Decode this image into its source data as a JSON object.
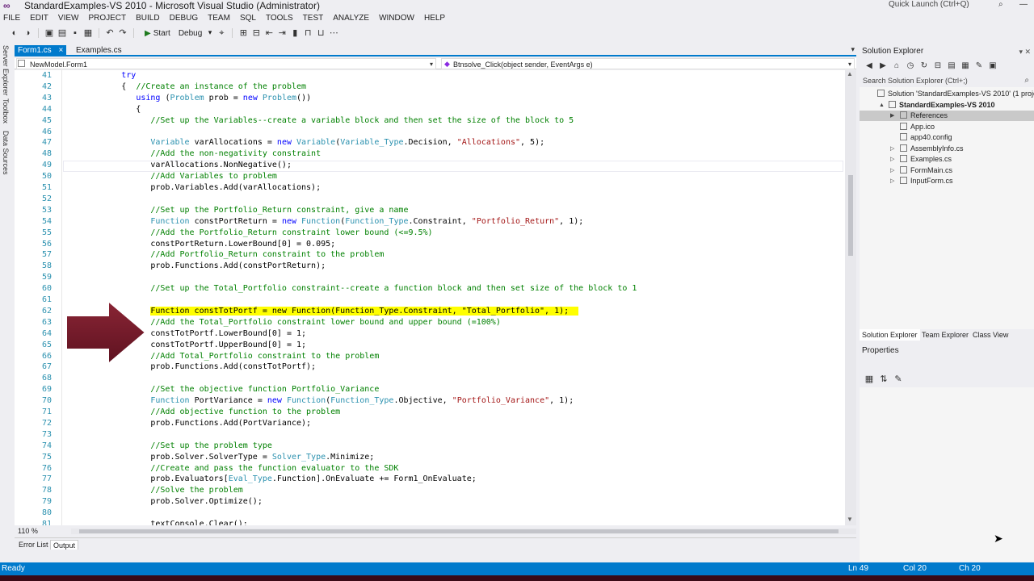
{
  "window": {
    "title": "StandardExamples-VS 2010 - Microsoft Visual Studio (Administrator)",
    "quick_launch": "Quick Launch (Ctrl+Q)"
  },
  "menu": [
    "FILE",
    "EDIT",
    "VIEW",
    "PROJECT",
    "BUILD",
    "DEBUG",
    "TEAM",
    "SQL",
    "TOOLS",
    "TEST",
    "ANALYZE",
    "WINDOW",
    "HELP"
  ],
  "toolbar": {
    "start_label": "Start",
    "config_label": "Debug"
  },
  "left_strip": [
    "Server Explorer",
    "Toolbox",
    "Data Sources"
  ],
  "doc_tabs": [
    {
      "label": "Form1.cs",
      "active": true
    },
    {
      "label": "Examples.cs",
      "active": false
    }
  ],
  "nav": {
    "class_selector": "NewModel.Form1",
    "member_selector": "Btnsolve_Click(object sender, EventArgs e)"
  },
  "editor": {
    "zoom": "110 %",
    "lines": [
      {
        "n": "41",
        "parts": [
          {
            "t": "            "
          },
          {
            "t": "try",
            "c": "kw"
          }
        ]
      },
      {
        "n": "42",
        "parts": [
          {
            "t": "            {  "
          },
          {
            "t": "//Create an instance of the problem",
            "c": "cm"
          }
        ]
      },
      {
        "n": "43",
        "parts": [
          {
            "t": "               "
          },
          {
            "t": "using",
            "c": "kw"
          },
          {
            "t": " ("
          },
          {
            "t": "Problem",
            "c": "ty"
          },
          {
            "t": " prob = "
          },
          {
            "t": "new",
            "c": "kw"
          },
          {
            "t": " "
          },
          {
            "t": "Problem",
            "c": "ty"
          },
          {
            "t": "())"
          }
        ]
      },
      {
        "n": "44",
        "parts": [
          {
            "t": "               {"
          }
        ]
      },
      {
        "n": "45",
        "parts": [
          {
            "t": "                  "
          },
          {
            "t": "//Set up the Variables--create a variable block and then set the size of the block to 5",
            "c": "cm"
          }
        ]
      },
      {
        "n": "46",
        "parts": [
          {
            "t": ""
          }
        ]
      },
      {
        "n": "47",
        "parts": [
          {
            "t": "                  "
          },
          {
            "t": "Variable",
            "c": "ty"
          },
          {
            "t": " varAllocations = "
          },
          {
            "t": "new",
            "c": "kw"
          },
          {
            "t": " "
          },
          {
            "t": "Variable",
            "c": "ty"
          },
          {
            "t": "("
          },
          {
            "t": "Variable_Type",
            "c": "ty"
          },
          {
            "t": ".Decision, "
          },
          {
            "t": "\"Allocations\"",
            "c": "st"
          },
          {
            "t": ", 5);"
          }
        ]
      },
      {
        "n": "48",
        "parts": [
          {
            "t": "                  "
          },
          {
            "t": "//Add the non-negativity constraint",
            "c": "cm"
          }
        ]
      },
      {
        "n": "49",
        "parts": [
          {
            "t": "                  varAllocations.NonNegative();"
          }
        ]
      },
      {
        "n": "50",
        "parts": [
          {
            "t": "                  "
          },
          {
            "t": "//Add Variables to problem",
            "c": "cm"
          }
        ]
      },
      {
        "n": "51",
        "parts": [
          {
            "t": "                  prob.Variables.Add(varAllocations);"
          }
        ]
      },
      {
        "n": "52",
        "parts": [
          {
            "t": ""
          }
        ]
      },
      {
        "n": "53",
        "parts": [
          {
            "t": "                  "
          },
          {
            "t": "//Set up the Portfolio_Return constraint, give a name",
            "c": "cm"
          }
        ]
      },
      {
        "n": "54",
        "parts": [
          {
            "t": "                  "
          },
          {
            "t": "Function",
            "c": "ty"
          },
          {
            "t": " constPortReturn = "
          },
          {
            "t": "new",
            "c": "kw"
          },
          {
            "t": " "
          },
          {
            "t": "Function",
            "c": "ty"
          },
          {
            "t": "("
          },
          {
            "t": "Function_Type",
            "c": "ty"
          },
          {
            "t": ".Constraint, "
          },
          {
            "t": "\"Portfolio_Return\"",
            "c": "st"
          },
          {
            "t": ", 1);"
          }
        ]
      },
      {
        "n": "55",
        "parts": [
          {
            "t": "                  "
          },
          {
            "t": "//Add the Portfolio_Return constraint lower bound (<=9.5%)",
            "c": "cm"
          }
        ]
      },
      {
        "n": "56",
        "parts": [
          {
            "t": "                  constPortReturn.LowerBound[0] = 0.095;"
          }
        ]
      },
      {
        "n": "57",
        "parts": [
          {
            "t": "                  "
          },
          {
            "t": "//Add Portfolio_Return constraint to the problem",
            "c": "cm"
          }
        ]
      },
      {
        "n": "58",
        "parts": [
          {
            "t": "                  prob.Functions.Add(constPortReturn);"
          }
        ]
      },
      {
        "n": "59",
        "parts": [
          {
            "t": ""
          }
        ]
      },
      {
        "n": "60",
        "parts": [
          {
            "t": "                  "
          },
          {
            "t": "//Set up the Total_Portfolio constraint--create a function block and then set size of the block to 1",
            "c": "cm"
          }
        ]
      },
      {
        "n": "61",
        "parts": [
          {
            "t": ""
          }
        ]
      },
      {
        "n": "62",
        "highlight": true,
        "parts": [
          {
            "t": "                  Function constTotPortf = new Function(Function_Type.Constraint, \"Total_Portfolio\", 1);"
          }
        ]
      },
      {
        "n": "63",
        "parts": [
          {
            "t": "                  "
          },
          {
            "t": "//Add the Total_Portfolio constraint lower bound and upper bound (=100%)",
            "c": "cm"
          }
        ]
      },
      {
        "n": "64",
        "parts": [
          {
            "t": "                  constTotPortf.LowerBound[0] = 1;"
          }
        ]
      },
      {
        "n": "65",
        "parts": [
          {
            "t": "                  constTotPortf.UpperBound[0] = 1;"
          }
        ]
      },
      {
        "n": "66",
        "parts": [
          {
            "t": "                  "
          },
          {
            "t": "//Add Total_Portfolio constraint to the problem",
            "c": "cm"
          }
        ]
      },
      {
        "n": "67",
        "parts": [
          {
            "t": "                  prob.Functions.Add(constTotPortf);"
          }
        ]
      },
      {
        "n": "68",
        "parts": [
          {
            "t": ""
          }
        ]
      },
      {
        "n": "69",
        "parts": [
          {
            "t": "                  "
          },
          {
            "t": "//Set the objective function Portfolio_Variance",
            "c": "cm"
          }
        ]
      },
      {
        "n": "70",
        "parts": [
          {
            "t": "                  "
          },
          {
            "t": "Function",
            "c": "ty"
          },
          {
            "t": " PortVariance = "
          },
          {
            "t": "new",
            "c": "kw"
          },
          {
            "t": " "
          },
          {
            "t": "Function",
            "c": "ty"
          },
          {
            "t": "("
          },
          {
            "t": "Function_Type",
            "c": "ty"
          },
          {
            "t": ".Objective, "
          },
          {
            "t": "\"Portfolio_Variance\"",
            "c": "st"
          },
          {
            "t": ", 1);"
          }
        ]
      },
      {
        "n": "71",
        "parts": [
          {
            "t": "                  "
          },
          {
            "t": "//Add objective function to the problem",
            "c": "cm"
          }
        ]
      },
      {
        "n": "72",
        "parts": [
          {
            "t": "                  prob.Functions.Add(PortVariance);"
          }
        ]
      },
      {
        "n": "73",
        "parts": [
          {
            "t": ""
          }
        ]
      },
      {
        "n": "74",
        "parts": [
          {
            "t": "                  "
          },
          {
            "t": "//Set up the problem type",
            "c": "cm"
          }
        ]
      },
      {
        "n": "75",
        "parts": [
          {
            "t": "                  prob.Solver.SolverType = "
          },
          {
            "t": "Solver_Type",
            "c": "ty"
          },
          {
            "t": ".Minimize;"
          }
        ]
      },
      {
        "n": "76",
        "parts": [
          {
            "t": "                  "
          },
          {
            "t": "//Create and pass the function evaluator to the SDK",
            "c": "cm"
          }
        ]
      },
      {
        "n": "77",
        "parts": [
          {
            "t": "                  prob.Evaluators["
          },
          {
            "t": "Eval_Type",
            "c": "ty"
          },
          {
            "t": ".Function].OnEvaluate += Form1_OnEvaluate;"
          }
        ]
      },
      {
        "n": "78",
        "parts": [
          {
            "t": "                  "
          },
          {
            "t": "//Solve the problem",
            "c": "cm"
          }
        ]
      },
      {
        "n": "79",
        "parts": [
          {
            "t": "                  prob.Solver.Optimize();"
          }
        ]
      },
      {
        "n": "80",
        "parts": [
          {
            "t": ""
          }
        ]
      },
      {
        "n": "81",
        "parts": [
          {
            "t": "                  textConsole.Clear();"
          }
        ]
      }
    ]
  },
  "bottom_tabs": [
    {
      "label": "Error List",
      "active": false
    },
    {
      "label": "Output",
      "active": true
    }
  ],
  "solution_explorer": {
    "title": "Solution Explorer",
    "search_placeholder": "Search Solution Explorer (Ctrl+;)",
    "items": [
      {
        "label": "Solution 'StandardExamples-VS 2010' (1 project)",
        "level": 0,
        "bold": false,
        "expander": ""
      },
      {
        "label": "StandardExamples-VS 2010",
        "level": 1,
        "bold": true,
        "expander": "▲"
      },
      {
        "label": "References",
        "level": 2,
        "bold": false,
        "expander": "▶",
        "selected": true
      },
      {
        "label": "App.ico",
        "level": 2,
        "bold": false,
        "expander": ""
      },
      {
        "label": "app40.config",
        "level": 2,
        "bold": false,
        "expander": ""
      },
      {
        "label": "AssemblyInfo.cs",
        "level": 2,
        "bold": false,
        "expander": "▷"
      },
      {
        "label": "Examples.cs",
        "level": 2,
        "bold": false,
        "expander": "▷"
      },
      {
        "label": "FormMain.cs",
        "level": 2,
        "bold": false,
        "expander": "▷"
      },
      {
        "label": "InputForm.cs",
        "level": 2,
        "bold": false,
        "expander": "▷"
      }
    ],
    "tabs": [
      {
        "label": "Solution Explorer",
        "active": true
      },
      {
        "label": "Team Explorer",
        "active": false
      },
      {
        "label": "Class View",
        "active": false
      }
    ]
  },
  "properties": {
    "title": "Properties"
  },
  "status": {
    "ready": "Ready",
    "ln": "Ln 49",
    "col": "Col 20",
    "ch": "Ch 20"
  },
  "colors": {
    "accent": "#007acc",
    "highlight": "#ffff00",
    "arrow": "#7b1b2a"
  }
}
